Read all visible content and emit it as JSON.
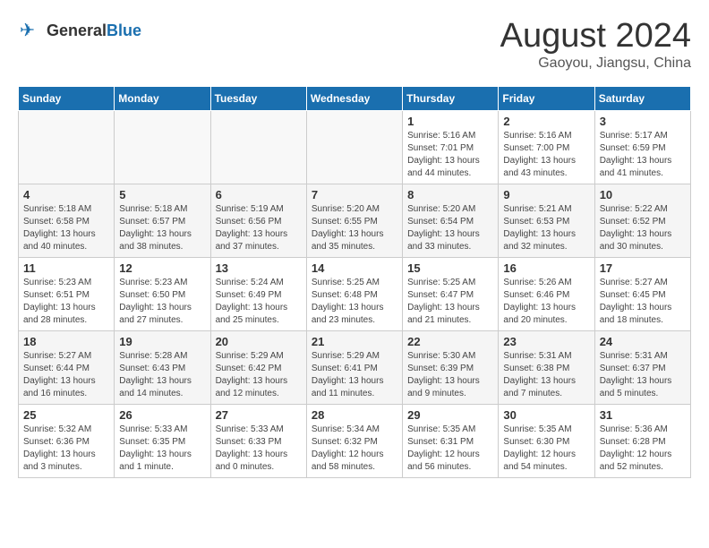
{
  "header": {
    "logo_general": "General",
    "logo_blue": "Blue",
    "title": "August 2024",
    "subtitle": "Gaoyou, Jiangsu, China"
  },
  "weekdays": [
    "Sunday",
    "Monday",
    "Tuesday",
    "Wednesday",
    "Thursday",
    "Friday",
    "Saturday"
  ],
  "weeks": [
    [
      {
        "day": "",
        "info": ""
      },
      {
        "day": "",
        "info": ""
      },
      {
        "day": "",
        "info": ""
      },
      {
        "day": "",
        "info": ""
      },
      {
        "day": "1",
        "info": "Sunrise: 5:16 AM\nSunset: 7:01 PM\nDaylight: 13 hours\nand 44 minutes."
      },
      {
        "day": "2",
        "info": "Sunrise: 5:16 AM\nSunset: 7:00 PM\nDaylight: 13 hours\nand 43 minutes."
      },
      {
        "day": "3",
        "info": "Sunrise: 5:17 AM\nSunset: 6:59 PM\nDaylight: 13 hours\nand 41 minutes."
      }
    ],
    [
      {
        "day": "4",
        "info": "Sunrise: 5:18 AM\nSunset: 6:58 PM\nDaylight: 13 hours\nand 40 minutes."
      },
      {
        "day": "5",
        "info": "Sunrise: 5:18 AM\nSunset: 6:57 PM\nDaylight: 13 hours\nand 38 minutes."
      },
      {
        "day": "6",
        "info": "Sunrise: 5:19 AM\nSunset: 6:56 PM\nDaylight: 13 hours\nand 37 minutes."
      },
      {
        "day": "7",
        "info": "Sunrise: 5:20 AM\nSunset: 6:55 PM\nDaylight: 13 hours\nand 35 minutes."
      },
      {
        "day": "8",
        "info": "Sunrise: 5:20 AM\nSunset: 6:54 PM\nDaylight: 13 hours\nand 33 minutes."
      },
      {
        "day": "9",
        "info": "Sunrise: 5:21 AM\nSunset: 6:53 PM\nDaylight: 13 hours\nand 32 minutes."
      },
      {
        "day": "10",
        "info": "Sunrise: 5:22 AM\nSunset: 6:52 PM\nDaylight: 13 hours\nand 30 minutes."
      }
    ],
    [
      {
        "day": "11",
        "info": "Sunrise: 5:23 AM\nSunset: 6:51 PM\nDaylight: 13 hours\nand 28 minutes."
      },
      {
        "day": "12",
        "info": "Sunrise: 5:23 AM\nSunset: 6:50 PM\nDaylight: 13 hours\nand 27 minutes."
      },
      {
        "day": "13",
        "info": "Sunrise: 5:24 AM\nSunset: 6:49 PM\nDaylight: 13 hours\nand 25 minutes."
      },
      {
        "day": "14",
        "info": "Sunrise: 5:25 AM\nSunset: 6:48 PM\nDaylight: 13 hours\nand 23 minutes."
      },
      {
        "day": "15",
        "info": "Sunrise: 5:25 AM\nSunset: 6:47 PM\nDaylight: 13 hours\nand 21 minutes."
      },
      {
        "day": "16",
        "info": "Sunrise: 5:26 AM\nSunset: 6:46 PM\nDaylight: 13 hours\nand 20 minutes."
      },
      {
        "day": "17",
        "info": "Sunrise: 5:27 AM\nSunset: 6:45 PM\nDaylight: 13 hours\nand 18 minutes."
      }
    ],
    [
      {
        "day": "18",
        "info": "Sunrise: 5:27 AM\nSunset: 6:44 PM\nDaylight: 13 hours\nand 16 minutes."
      },
      {
        "day": "19",
        "info": "Sunrise: 5:28 AM\nSunset: 6:43 PM\nDaylight: 13 hours\nand 14 minutes."
      },
      {
        "day": "20",
        "info": "Sunrise: 5:29 AM\nSunset: 6:42 PM\nDaylight: 13 hours\nand 12 minutes."
      },
      {
        "day": "21",
        "info": "Sunrise: 5:29 AM\nSunset: 6:41 PM\nDaylight: 13 hours\nand 11 minutes."
      },
      {
        "day": "22",
        "info": "Sunrise: 5:30 AM\nSunset: 6:39 PM\nDaylight: 13 hours\nand 9 minutes."
      },
      {
        "day": "23",
        "info": "Sunrise: 5:31 AM\nSunset: 6:38 PM\nDaylight: 13 hours\nand 7 minutes."
      },
      {
        "day": "24",
        "info": "Sunrise: 5:31 AM\nSunset: 6:37 PM\nDaylight: 13 hours\nand 5 minutes."
      }
    ],
    [
      {
        "day": "25",
        "info": "Sunrise: 5:32 AM\nSunset: 6:36 PM\nDaylight: 13 hours\nand 3 minutes."
      },
      {
        "day": "26",
        "info": "Sunrise: 5:33 AM\nSunset: 6:35 PM\nDaylight: 13 hours\nand 1 minute."
      },
      {
        "day": "27",
        "info": "Sunrise: 5:33 AM\nSunset: 6:33 PM\nDaylight: 13 hours\nand 0 minutes."
      },
      {
        "day": "28",
        "info": "Sunrise: 5:34 AM\nSunset: 6:32 PM\nDaylight: 12 hours\nand 58 minutes."
      },
      {
        "day": "29",
        "info": "Sunrise: 5:35 AM\nSunset: 6:31 PM\nDaylight: 12 hours\nand 56 minutes."
      },
      {
        "day": "30",
        "info": "Sunrise: 5:35 AM\nSunset: 6:30 PM\nDaylight: 12 hours\nand 54 minutes."
      },
      {
        "day": "31",
        "info": "Sunrise: 5:36 AM\nSunset: 6:28 PM\nDaylight: 12 hours\nand 52 minutes."
      }
    ]
  ]
}
